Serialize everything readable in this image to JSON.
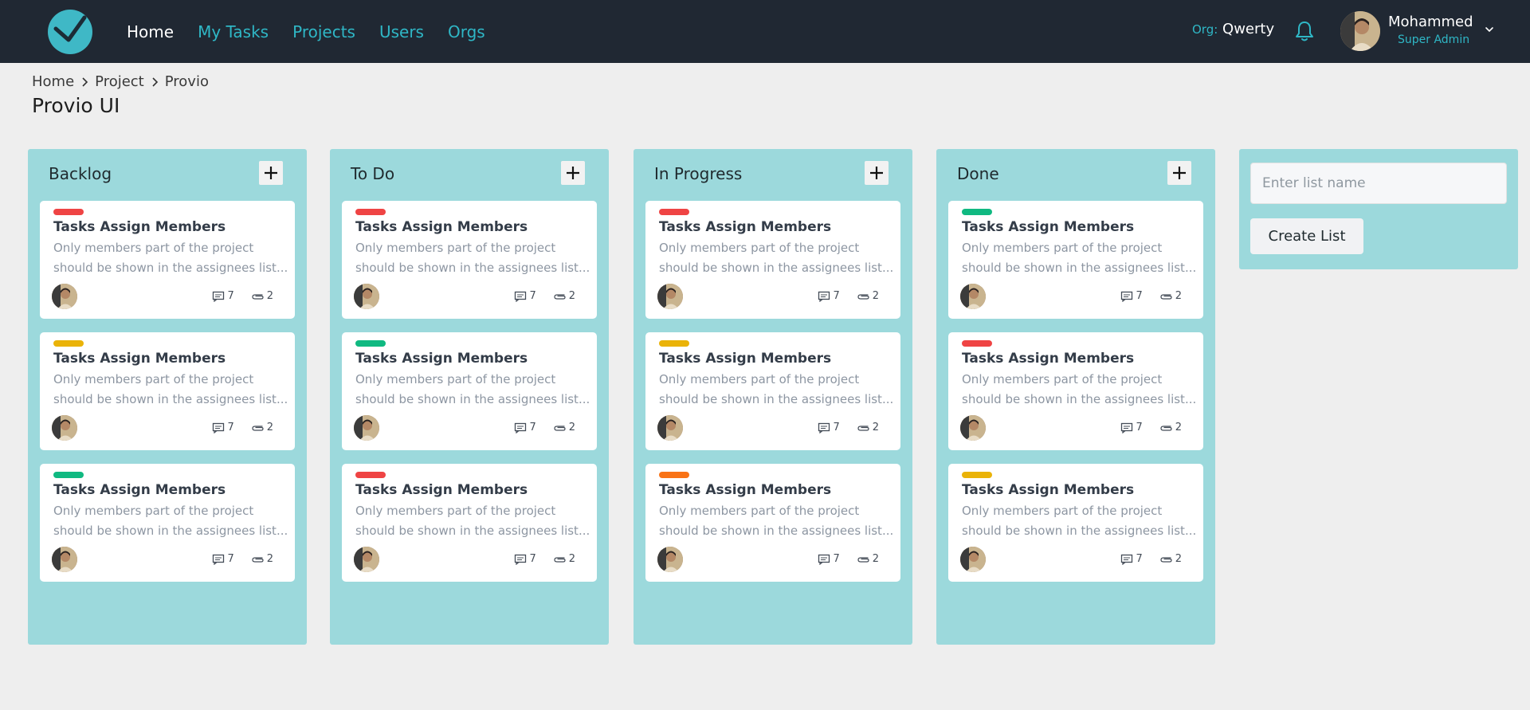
{
  "nav": {
    "links": [
      "Home",
      "My Tasks",
      "Projects",
      "Users",
      "Orgs"
    ],
    "org_label": "Org:",
    "org_name": "Qwerty",
    "user_name": "Mohammed",
    "user_role": "Super Admin"
  },
  "breadcrumb": [
    "Home",
    "Project",
    "Provio"
  ],
  "page_title": "Provio UI",
  "colors": {
    "red": "#ef4444",
    "yellow": "#eab308",
    "green": "#10b981",
    "orange": "#f97316",
    "list_bg": "#9cd9dc",
    "accent": "#2fb7c6"
  },
  "lists": [
    {
      "title": "Backlog",
      "cards": [
        {
          "tag": "red",
          "title": "Tasks Assign Members",
          "desc1": "Only members part of the project",
          "desc2": "should be shown in the assignees list...",
          "comments": "7",
          "attachments": "2"
        },
        {
          "tag": "yellow",
          "title": "Tasks Assign Members",
          "desc1": "Only members part of the project",
          "desc2": "should be shown in the assignees list...",
          "comments": "7",
          "attachments": "2"
        },
        {
          "tag": "green",
          "title": "Tasks Assign Members",
          "desc1": "Only members part of the project",
          "desc2": "should be shown in the assignees list...",
          "comments": "7",
          "attachments": "2"
        }
      ]
    },
    {
      "title": "To Do",
      "cards": [
        {
          "tag": "red",
          "title": "Tasks Assign Members",
          "desc1": "Only members part of the project",
          "desc2": "should be shown in the assignees list...",
          "comments": "7",
          "attachments": "2"
        },
        {
          "tag": "green",
          "title": "Tasks Assign Members",
          "desc1": "Only members part of the project",
          "desc2": "should be shown in the assignees list...",
          "comments": "7",
          "attachments": "2"
        },
        {
          "tag": "red",
          "title": "Tasks Assign Members",
          "desc1": "Only members part of the project",
          "desc2": "should be shown in the assignees list...",
          "comments": "7",
          "attachments": "2"
        }
      ]
    },
    {
      "title": "In Progress",
      "cards": [
        {
          "tag": "red",
          "title": "Tasks Assign Members",
          "desc1": "Only members part of the project",
          "desc2": "should be shown in the assignees list...",
          "comments": "7",
          "attachments": "2"
        },
        {
          "tag": "yellow",
          "title": "Tasks Assign Members",
          "desc1": "Only members part of the project",
          "desc2": "should be shown in the assignees list...",
          "comments": "7",
          "attachments": "2"
        },
        {
          "tag": "orange",
          "title": "Tasks Assign Members",
          "desc1": "Only members part of the project",
          "desc2": "should be shown in the assignees list...",
          "comments": "7",
          "attachments": "2"
        }
      ]
    },
    {
      "title": "Done",
      "cards": [
        {
          "tag": "green",
          "title": "Tasks Assign Members",
          "desc1": "Only members part of the project",
          "desc2": "should be shown in the assignees list...",
          "comments": "7",
          "attachments": "2"
        },
        {
          "tag": "red",
          "title": "Tasks Assign Members",
          "desc1": "Only members part of the project",
          "desc2": "should be shown in the assignees list...",
          "comments": "7",
          "attachments": "2"
        },
        {
          "tag": "yellow",
          "title": "Tasks Assign Members",
          "desc1": "Only members part of the project",
          "desc2": "should be shown in the assignees list...",
          "comments": "7",
          "attachments": "2"
        }
      ]
    }
  ],
  "new_list": {
    "placeholder": "Enter list name",
    "button_label": "Create List"
  }
}
